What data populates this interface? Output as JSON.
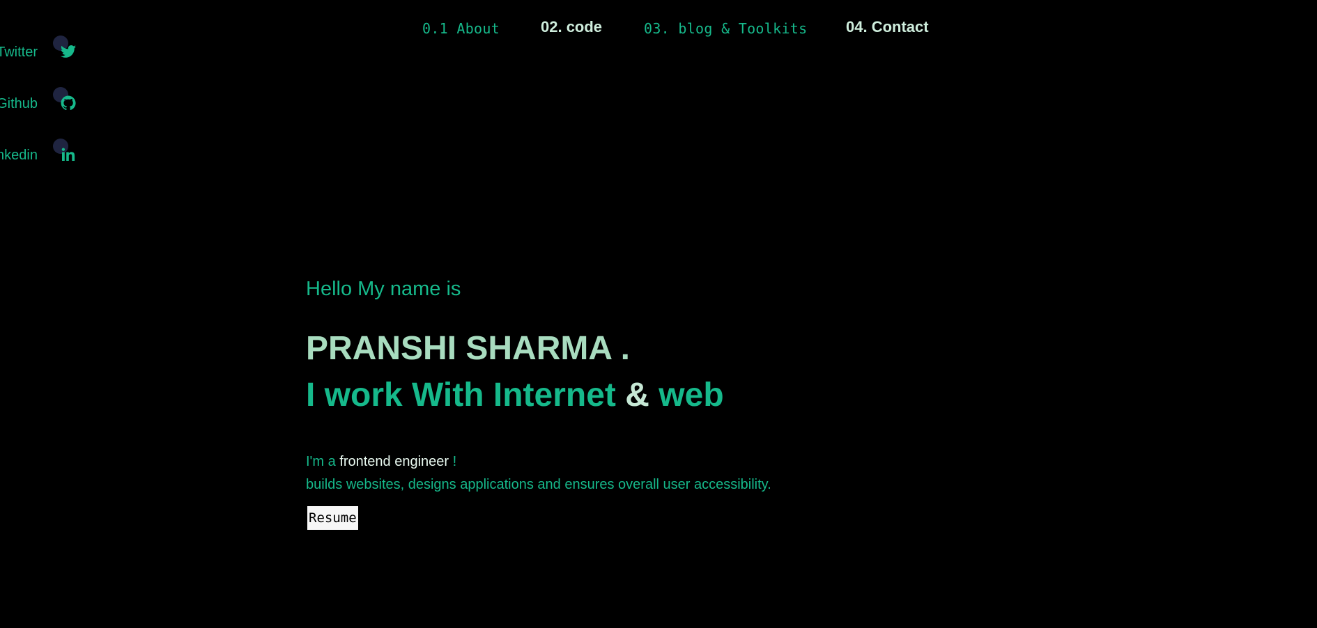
{
  "nav": {
    "about": "0.1 About",
    "code": "02. code",
    "blog": "03. blog & Toolkits",
    "contact": "04. Contact"
  },
  "social": {
    "twitter": "Twitter",
    "github": "Github",
    "linkedin": "Linkedin"
  },
  "hero": {
    "greeting": "Hello My name is",
    "name": "PRANSHI SHARMA .",
    "tagline_part1": "I work With Internet",
    "tagline_amp": "&",
    "tagline_part2": "web",
    "intro_prefix": "I'm a",
    "intro_role": "frontend engineer",
    "intro_suffix": "!",
    "description": "builds websites, designs applications and ensures overall user accessibility.",
    "resume_label": "Resume"
  },
  "icons": {
    "twitter": "twitter-icon",
    "github": "github-icon",
    "linkedin": "linkedin-icon"
  },
  "colors": {
    "background": "#000000",
    "accent": "#16b98b",
    "name": "#a8dcbf",
    "nav_bold": "#cfeedd",
    "dot": "#1f2440"
  }
}
